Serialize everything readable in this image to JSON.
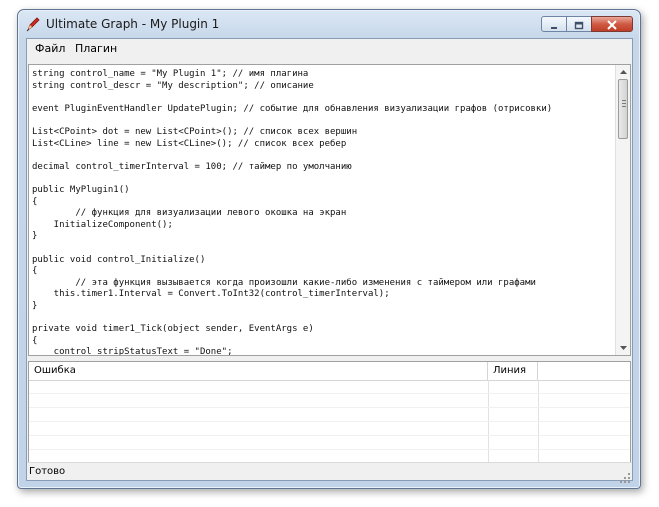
{
  "window": {
    "title": "Ultimate Graph - My Plugin 1",
    "icon": "pencil-icon",
    "controls": [
      "minimize-icon",
      "maximize-icon",
      "close-icon"
    ]
  },
  "menu": {
    "items": [
      "Файл",
      "Плагин"
    ]
  },
  "editor": {
    "lines": [
      "string control_name = \"My Plugin 1\"; // имя плагина",
      "string control_descr = \"My description\"; // описание",
      "",
      "event PluginEventHandler UpdatePlugin; // событие для обнавления визуализации графов (отрисовки)",
      "",
      "List<CPoint> dot = new List<CPoint>(); // список всех вершин",
      "List<CLine> line = new List<CLine>(); // список всех ребер",
      "",
      "decimal control_timerInterval = 100; // таймер по умолчанию",
      "",
      "public MyPlugin1()",
      "{",
      "        // функция для визуализации левого окошка на экран",
      "    InitializeComponent();",
      "}",
      "",
      "public void control_Initialize()",
      "{",
      "        // эта функция вызывается когда произошли какие-либо изменения с таймером или графами",
      "    this.timer1.Interval = Convert.ToInt32(control_timerInterval);",
      "}",
      "",
      "private void timer1_Tick(object sender, EventArgs e)",
      "{",
      "    control_stripStatusText = \"Done\";"
    ]
  },
  "errors": {
    "columns": [
      "Ошибка",
      "Линия",
      ""
    ],
    "rows": []
  },
  "statusbar": {
    "text": "Готово"
  },
  "colors": {
    "frame": "#c6d7ea",
    "close_button": "#c03e27",
    "client": "#f0f0f0"
  }
}
